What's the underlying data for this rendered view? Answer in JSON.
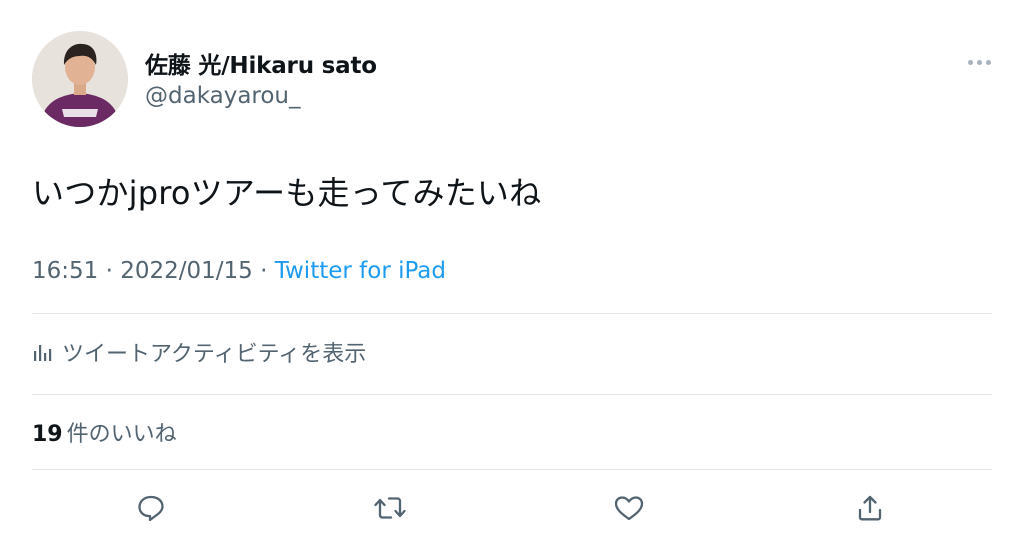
{
  "user": {
    "display_name": "佐藤 光/Hikaru sato",
    "handle": "@dakayarou_"
  },
  "tweet": {
    "text": "いつかjproツアーも走ってみたいね",
    "time": "16:51",
    "separator": " · ",
    "date": "2022/01/15",
    "source": "Twitter for iPad"
  },
  "activity": {
    "label": "ツイートアクティビティを表示"
  },
  "likes": {
    "count": "19",
    "label": "件のいいね"
  },
  "actions": {
    "reply_icon": "reply-icon",
    "retweet_icon": "retweet-icon",
    "like_icon": "heart-icon",
    "share_icon": "share-icon"
  },
  "colors": {
    "link": "#1d9bf0",
    "secondary_text": "#536471",
    "divider": "#e6e9ec",
    "jersey": "#6b2a63"
  }
}
